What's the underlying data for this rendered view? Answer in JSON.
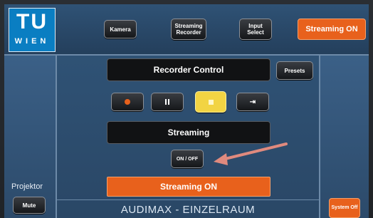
{
  "header": {
    "logo_tu": "TU",
    "logo_wien": "WIEN",
    "buttons": [
      {
        "label": "Kamera"
      },
      {
        "label": "Streaming Recorder"
      },
      {
        "label": "Input Select"
      }
    ],
    "status_button": "Streaming ON"
  },
  "main": {
    "recorder_title": "Recorder Control",
    "presets_label": "Presets",
    "controls": [
      {
        "icon": "record-icon"
      },
      {
        "icon": "pause-icon"
      },
      {
        "icon": "stop-icon"
      },
      {
        "icon": "skip-end-icon"
      }
    ],
    "streaming_label": "Streaming",
    "onoff_label": "ON / OFF",
    "status_bar": "Streaming ON"
  },
  "left": {
    "projektor_label": "Projektor",
    "mute_label": "Mute"
  },
  "right": {
    "system_off_label": "System Off"
  },
  "footer": {
    "room_title": "AUDIMAX - EINZELRAUM"
  },
  "colors": {
    "accent_orange": "#e8611c",
    "stop_yellow": "#f2d443",
    "arrow": "#e08a7e"
  }
}
